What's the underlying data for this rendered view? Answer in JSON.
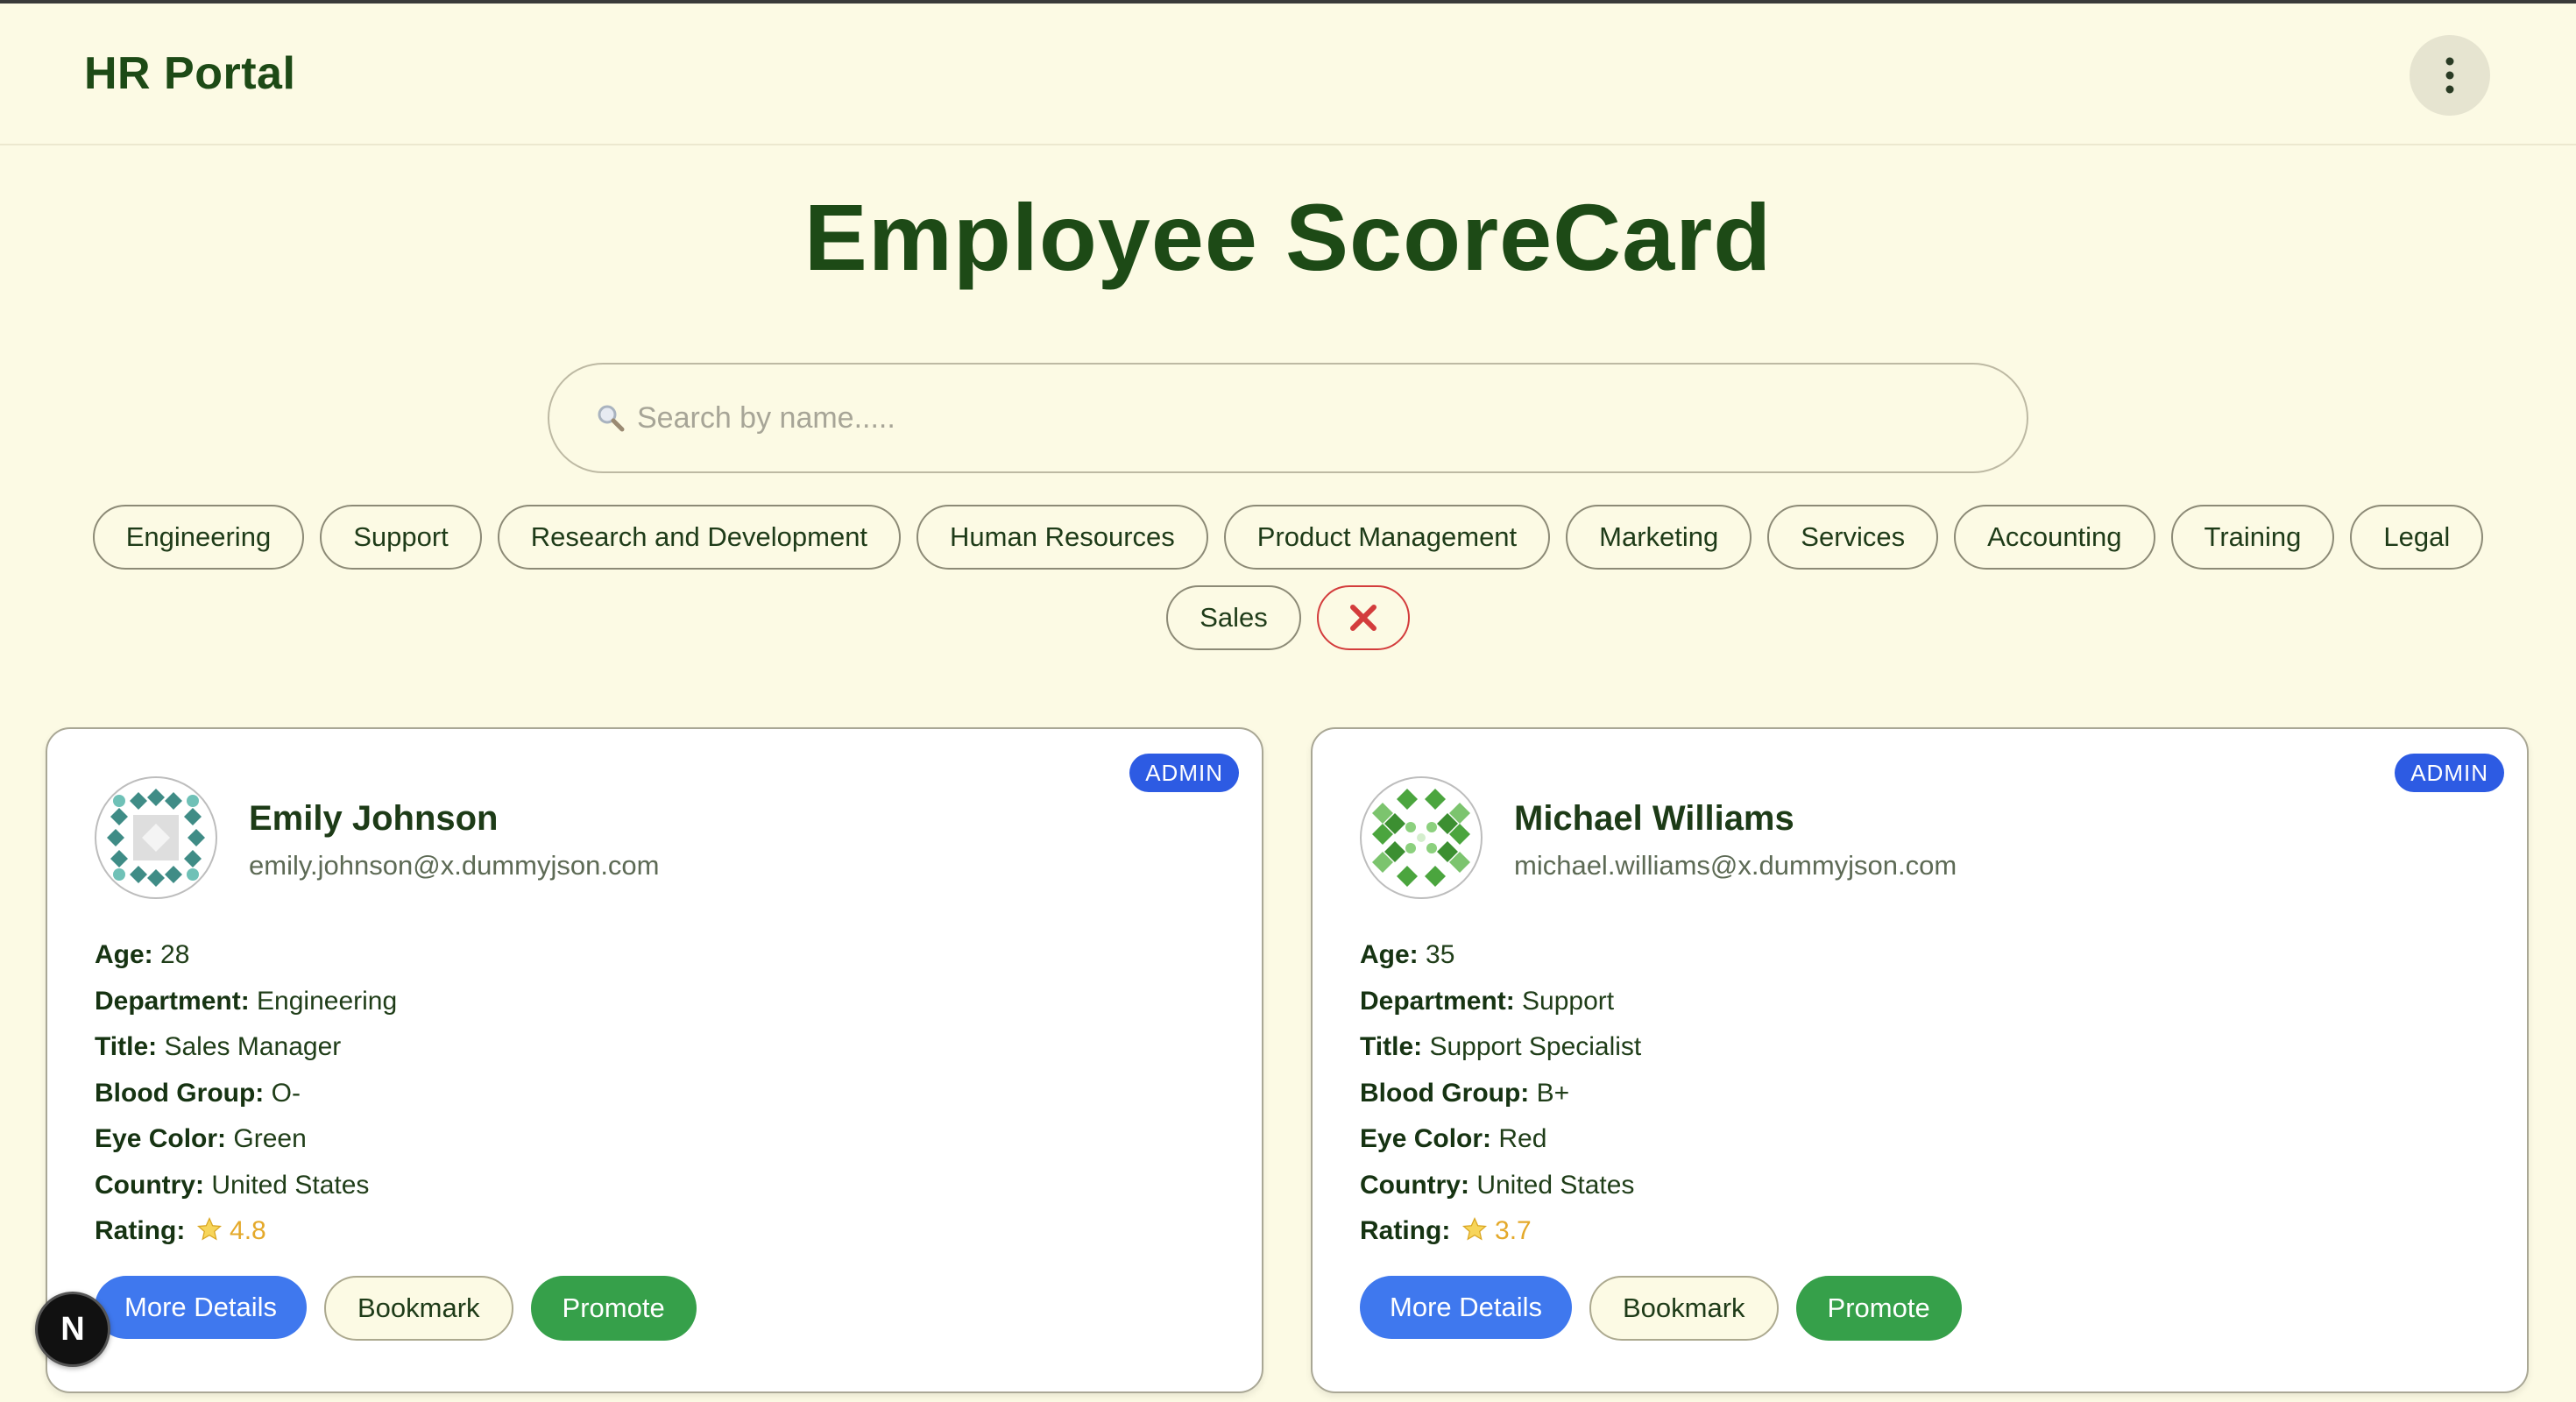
{
  "header": {
    "brand": "HR Portal",
    "menu_icon": "vertical-dots-icon"
  },
  "page": {
    "title": "Employee ScoreCard"
  },
  "search": {
    "placeholder": "Search by name.....",
    "value": "",
    "icon": "magnifier-icon"
  },
  "filters": {
    "items": [
      "Engineering",
      "Support",
      "Research and Development",
      "Human Resources",
      "Product Management",
      "Marketing",
      "Services",
      "Accounting",
      "Training",
      "Legal",
      "Sales"
    ],
    "clear_icon": "close-x-icon",
    "clear_color": "#d33c3c"
  },
  "labels": {
    "age": "Age:",
    "department": "Department:",
    "title": "Title:",
    "blood_group": "Blood Group:",
    "eye_color": "Eye Color:",
    "country": "Country:",
    "rating": "Rating:"
  },
  "employees": [
    {
      "role": "ADMIN",
      "name": "Emily Johnson",
      "email": "emily.johnson@x.dummyjson.com",
      "age": "28",
      "department": "Engineering",
      "title": "Sales Manager",
      "blood_group": "O-",
      "eye_color": "Green",
      "country": "United States",
      "rating": "4.8",
      "avatar_icon": "identicon-teal",
      "avatar_color": "#3f8c86"
    },
    {
      "role": "ADMIN",
      "name": "Michael Williams",
      "email": "michael.williams@x.dummyjson.com",
      "age": "35",
      "department": "Support",
      "title": "Support Specialist",
      "blood_group": "B+",
      "eye_color": "Red",
      "country": "United States",
      "rating": "3.7",
      "avatar_icon": "identicon-green",
      "avatar_color": "#4ba53e"
    }
  ],
  "card_actions": {
    "details": "More Details",
    "bookmark": "Bookmark",
    "promote": "Promote"
  },
  "colors": {
    "background": "#fcfae4",
    "primary_text": "#1d4a16",
    "admin_badge": "#2d5be3",
    "details_button": "#3f78ee",
    "promote_button": "#36a04a",
    "rating": "#e4a92a"
  },
  "dev_badge": {
    "letter": "N"
  }
}
